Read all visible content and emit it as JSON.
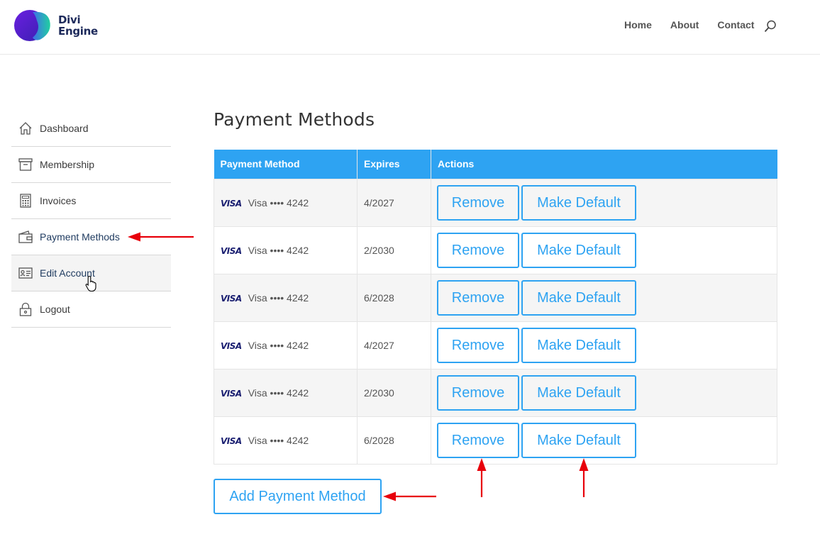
{
  "brand": {
    "line1": "Divi",
    "line2": "Engine"
  },
  "nav": {
    "items": [
      "Home",
      "About",
      "Contact"
    ]
  },
  "sidebar": {
    "items": [
      {
        "label": "Dashboard",
        "icon": "home-icon"
      },
      {
        "label": "Membership",
        "icon": "archive-box-icon"
      },
      {
        "label": "Invoices",
        "icon": "calculator-icon"
      },
      {
        "label": "Payment Methods",
        "icon": "wallet-icon"
      },
      {
        "label": "Edit Account",
        "icon": "id-card-icon"
      },
      {
        "label": "Logout",
        "icon": "lock-icon"
      }
    ]
  },
  "main": {
    "title": "Payment Methods",
    "columns": [
      "Payment Method",
      "Expires",
      "Actions"
    ],
    "rows": [
      {
        "brand": "VISA",
        "card": "Visa •••• 4242",
        "expires": "4/2027"
      },
      {
        "brand": "VISA",
        "card": "Visa •••• 4242",
        "expires": "2/2030"
      },
      {
        "brand": "VISA",
        "card": "Visa •••• 4242",
        "expires": "6/2028"
      },
      {
        "brand": "VISA",
        "card": "Visa •••• 4242",
        "expires": "4/2027"
      },
      {
        "brand": "VISA",
        "card": "Visa •••• 4242",
        "expires": "2/2030"
      },
      {
        "brand": "VISA",
        "card": "Visa •••• 4242",
        "expires": "6/2028"
      }
    ],
    "remove_label": "Remove",
    "make_default_label": "Make Default",
    "add_label": "Add Payment Method"
  },
  "colors": {
    "accent": "#2ea3f2",
    "annotation": "#e8000b",
    "brand_text": "#1d2a5b"
  }
}
